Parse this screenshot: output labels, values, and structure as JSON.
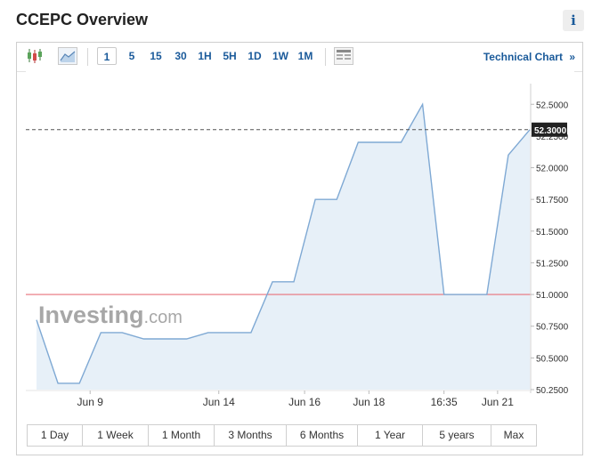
{
  "header": {
    "title": "CCEPC Overview",
    "info_label": "i"
  },
  "toolbar": {
    "timeframes": [
      "1",
      "5",
      "15",
      "30",
      "1H",
      "5H",
      "1D",
      "1W",
      "1M"
    ],
    "active_timeframe": "1",
    "technical_chart_label": "Technical Chart",
    "technical_chart_chevron": "»"
  },
  "watermark": {
    "brand": "Investing",
    "suffix": ".com"
  },
  "ranges": [
    "1 Day",
    "1 Week",
    "1 Month",
    "3 Months",
    "6 Months",
    "1 Year",
    "5 years",
    "Max"
  ],
  "colors": {
    "line": "#7fa9d4",
    "area": "#e3edf7",
    "reference": "#e8707a",
    "current_label_bg": "#222222",
    "link": "#1a5a9a"
  },
  "chart_data": {
    "type": "area",
    "x": [
      0,
      1,
      2,
      3,
      4,
      5,
      6,
      7,
      8,
      9,
      10,
      11,
      12,
      13,
      14,
      15,
      16,
      17,
      18,
      19,
      20,
      21,
      22,
      23
    ],
    "values": [
      50.8,
      50.3,
      50.3,
      50.7,
      50.7,
      50.65,
      50.65,
      50.65,
      50.7,
      50.7,
      50.7,
      51.1,
      51.1,
      51.75,
      51.75,
      52.2,
      52.2,
      52.2,
      52.5,
      51.0,
      51.0,
      51.0,
      52.1,
      52.3
    ],
    "x_tick_labels": [
      {
        "at": 2.5,
        "label": "Jun 9"
      },
      {
        "at": 8.5,
        "label": "Jun 14"
      },
      {
        "at": 12.5,
        "label": "Jun 16"
      },
      {
        "at": 15.5,
        "label": "Jun 18"
      },
      {
        "at": 19.0,
        "label": "16:35"
      },
      {
        "at": 21.5,
        "label": "Jun 21"
      }
    ],
    "y_ticks": [
      50.25,
      50.5,
      50.75,
      51.0,
      51.25,
      51.5,
      51.75,
      52.0,
      52.25,
      52.5
    ],
    "y_tick_labels": [
      "50.2500",
      "50.5000",
      "50.7500",
      "51.0000",
      "51.2500",
      "51.5000",
      "51.7500",
      "52.0000",
      "52.2500",
      "52.5000"
    ],
    "ylim": [
      50.25,
      52.6
    ],
    "reference_value": 51.0,
    "current_value": 52.3,
    "current_label": "52.3000",
    "grid": false
  }
}
